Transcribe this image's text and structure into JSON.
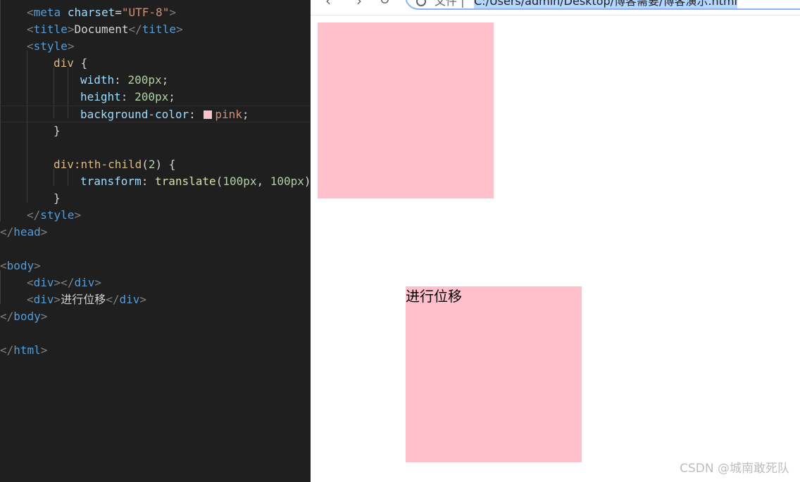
{
  "editor": {
    "lines": [
      {
        "indent": 1,
        "tokens": [
          [
            "punc",
            "<"
          ],
          [
            "tag",
            "meta"
          ],
          [
            "text",
            " "
          ],
          [
            "attr",
            "charset"
          ],
          [
            "text",
            "="
          ],
          [
            "str",
            "\"UTF-8\""
          ],
          [
            "punc",
            ">"
          ]
        ]
      },
      {
        "indent": 1,
        "tokens": [
          [
            "punc",
            "<"
          ],
          [
            "tag",
            "title"
          ],
          [
            "punc",
            ">"
          ],
          [
            "text",
            "Document"
          ],
          [
            "punc",
            "</"
          ],
          [
            "tag",
            "title"
          ],
          [
            "punc",
            ">"
          ]
        ]
      },
      {
        "indent": 1,
        "tokens": [
          [
            "punc",
            "<"
          ],
          [
            "tag",
            "style"
          ],
          [
            "punc",
            ">"
          ]
        ]
      },
      {
        "indent": 2,
        "tokens": [
          [
            "sel",
            "div"
          ],
          [
            "text",
            " {"
          ]
        ]
      },
      {
        "indent": 3,
        "tokens": [
          [
            "attr",
            "width"
          ],
          [
            "text",
            ": "
          ],
          [
            "num",
            "200px"
          ],
          [
            "text",
            ";"
          ]
        ]
      },
      {
        "indent": 3,
        "tokens": [
          [
            "attr",
            "height"
          ],
          [
            "text",
            ": "
          ],
          [
            "num",
            "200px"
          ],
          [
            "text",
            ";"
          ]
        ]
      },
      {
        "indent": 3,
        "current": true,
        "tokens": [
          [
            "attr",
            "background-color"
          ],
          [
            "text",
            ": "
          ],
          [
            "swatch",
            ""
          ],
          [
            "str",
            "pink"
          ],
          [
            "text",
            ";"
          ]
        ]
      },
      {
        "indent": 2,
        "tokens": [
          [
            "text",
            "}"
          ]
        ]
      },
      {
        "indent": 0,
        "tokens": []
      },
      {
        "indent": 2,
        "tokens": [
          [
            "sel",
            "div:nth-child"
          ],
          [
            "text",
            "("
          ],
          [
            "num",
            "2"
          ],
          [
            "text",
            ") {"
          ]
        ]
      },
      {
        "indent": 3,
        "tokens": [
          [
            "attr",
            "transform"
          ],
          [
            "text",
            ": "
          ],
          [
            "fn",
            "translate"
          ],
          [
            "text",
            "("
          ],
          [
            "num",
            "100px"
          ],
          [
            "text",
            ", "
          ],
          [
            "num",
            "100px"
          ],
          [
            "text",
            ")"
          ]
        ]
      },
      {
        "indent": 2,
        "tokens": [
          [
            "text",
            "}"
          ]
        ]
      },
      {
        "indent": 1,
        "tokens": [
          [
            "punc",
            "</"
          ],
          [
            "tag",
            "style"
          ],
          [
            "punc",
            ">"
          ]
        ]
      },
      {
        "indent": 0,
        "tokens": [
          [
            "punc",
            "</"
          ],
          [
            "tag",
            "head"
          ],
          [
            "punc",
            ">"
          ]
        ]
      },
      {
        "indent": 0,
        "tokens": []
      },
      {
        "indent": 0,
        "tokens": [
          [
            "punc",
            "<"
          ],
          [
            "tag",
            "body"
          ],
          [
            "punc",
            ">"
          ]
        ]
      },
      {
        "indent": 1,
        "tokens": [
          [
            "punc",
            "<"
          ],
          [
            "tag",
            "div"
          ],
          [
            "punc",
            "></"
          ],
          [
            "tag",
            "div"
          ],
          [
            "punc",
            ">"
          ]
        ]
      },
      {
        "indent": 1,
        "tokens": [
          [
            "punc",
            "<"
          ],
          [
            "tag",
            "div"
          ],
          [
            "punc",
            ">"
          ],
          [
            "text",
            "进行位移"
          ],
          [
            "punc",
            "</"
          ],
          [
            "tag",
            "div"
          ],
          [
            "punc",
            ">"
          ]
        ]
      },
      {
        "indent": 0,
        "tokens": [
          [
            "punc",
            "</"
          ],
          [
            "tag",
            "body"
          ],
          [
            "punc",
            ">"
          ]
        ]
      },
      {
        "indent": 0,
        "tokens": []
      },
      {
        "indent": 0,
        "tokens": [
          [
            "punc",
            "</"
          ],
          [
            "tag",
            "html"
          ],
          [
            "punc",
            ">"
          ]
        ]
      }
    ],
    "swatch_color": "#ffc0cb"
  },
  "browser": {
    "nav": {
      "back_icon": "‹",
      "forward_icon": "›",
      "reload_icon": "↻"
    },
    "address_bar": {
      "scheme_label": "文件 |",
      "url": "C:/Users/admin/Desktop/博客需要/博客演示.html"
    },
    "boxes": [
      {
        "text": ""
      },
      {
        "text": "进行位移"
      }
    ],
    "box_color": "#ffc0cb"
  },
  "watermark": "CSDN @城南敢死队"
}
